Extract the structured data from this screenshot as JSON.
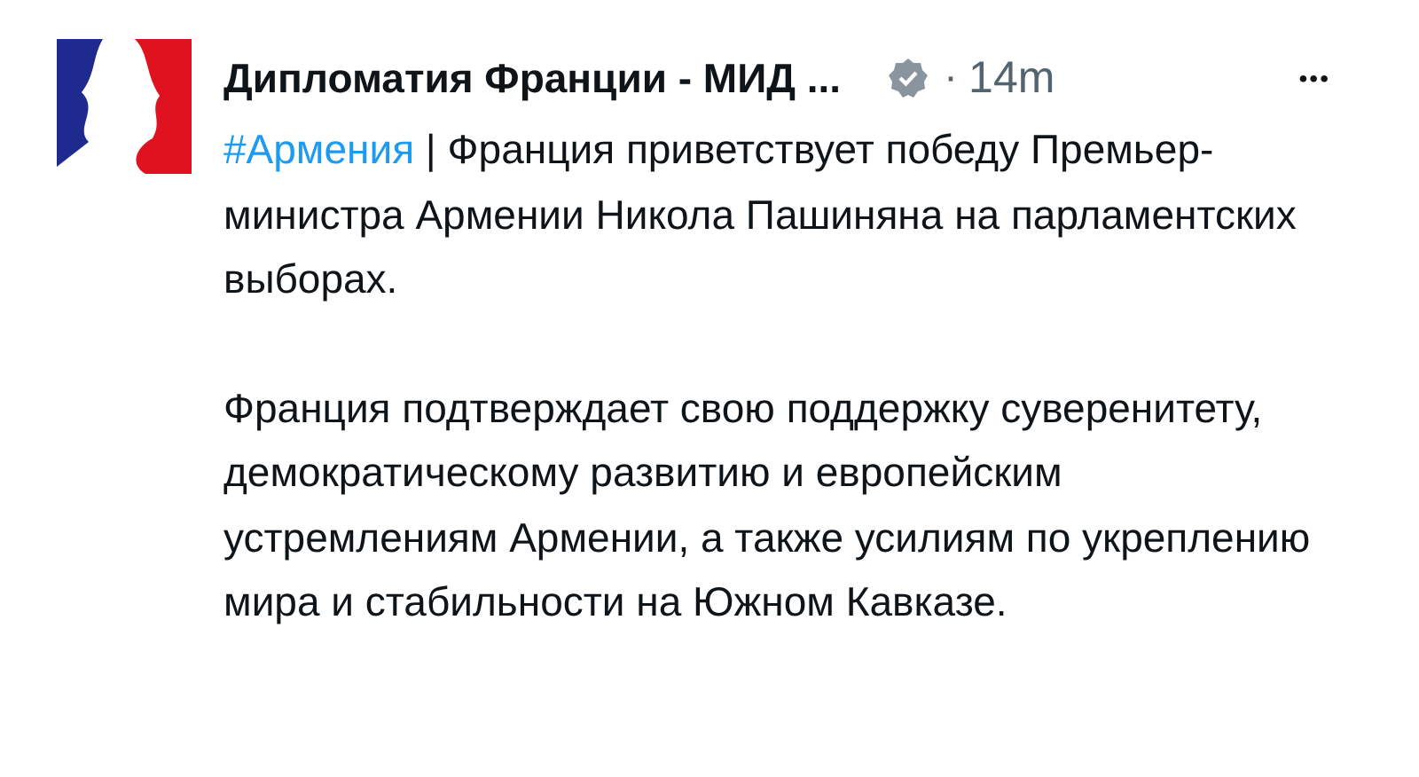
{
  "post": {
    "author": "Дипломатия Франции - МИД ...",
    "verified": true,
    "separator": "·",
    "time": "14m",
    "menu": "•••",
    "hashtag": "#Армения",
    "paragraphs": [
      "| Франция приветствует победу Премьер-министра Армении Никола Пашиняна на парламентских выборах.",
      "Франция подтверждает свою поддержку суверенитету, демократическому развитию и европейским устремлениям Армении, а также усилиям по укреплению мира и стабильности на Южном Кавказе."
    ]
  }
}
